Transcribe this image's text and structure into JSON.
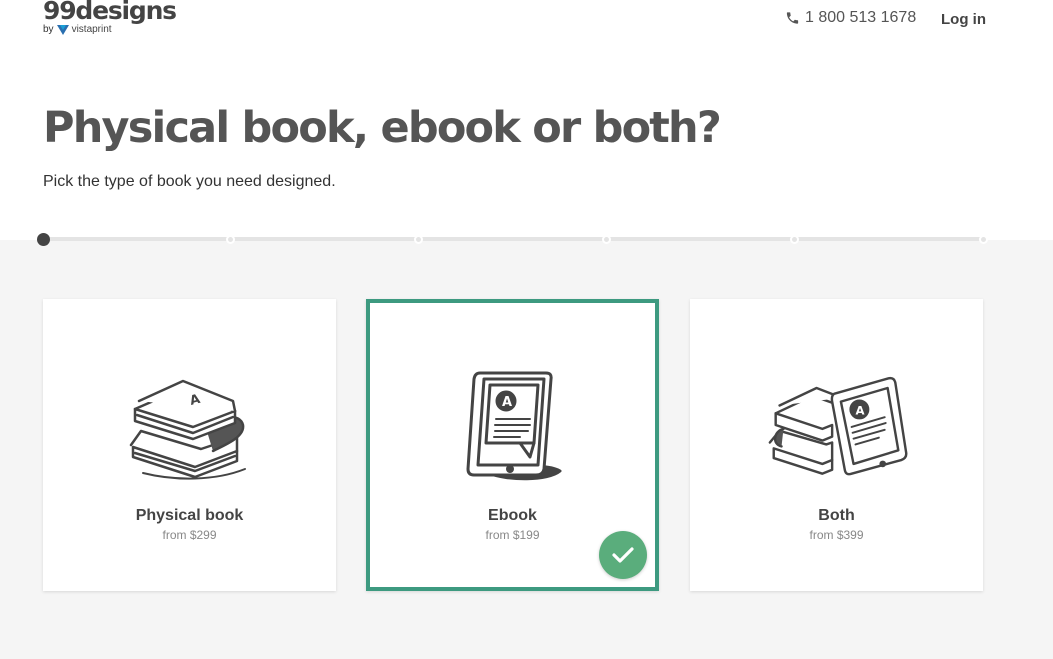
{
  "header": {
    "logo_text": "99designs",
    "logo_by": "by",
    "logo_partner": "vistaprint",
    "phone": "1 800 513 1678",
    "login_label": "Log in"
  },
  "main": {
    "title": "Physical book, ebook or both?",
    "subtitle": "Pick the type of book you need designed."
  },
  "progress": {
    "total_steps": 6,
    "current_step": 1
  },
  "options": [
    {
      "title": "Physical book",
      "price": "from $299",
      "icon": "physical-book-icon",
      "selected": false
    },
    {
      "title": "Ebook",
      "price": "from $199",
      "icon": "ebook-reader-icon",
      "selected": true
    },
    {
      "title": "Both",
      "price": "from $399",
      "icon": "books-and-ebook-icon",
      "selected": false
    }
  ],
  "colors": {
    "accent": "#3d9a80",
    "check": "#5aad7c",
    "background_section": "#f5f5f5",
    "text_dark": "#444444"
  }
}
